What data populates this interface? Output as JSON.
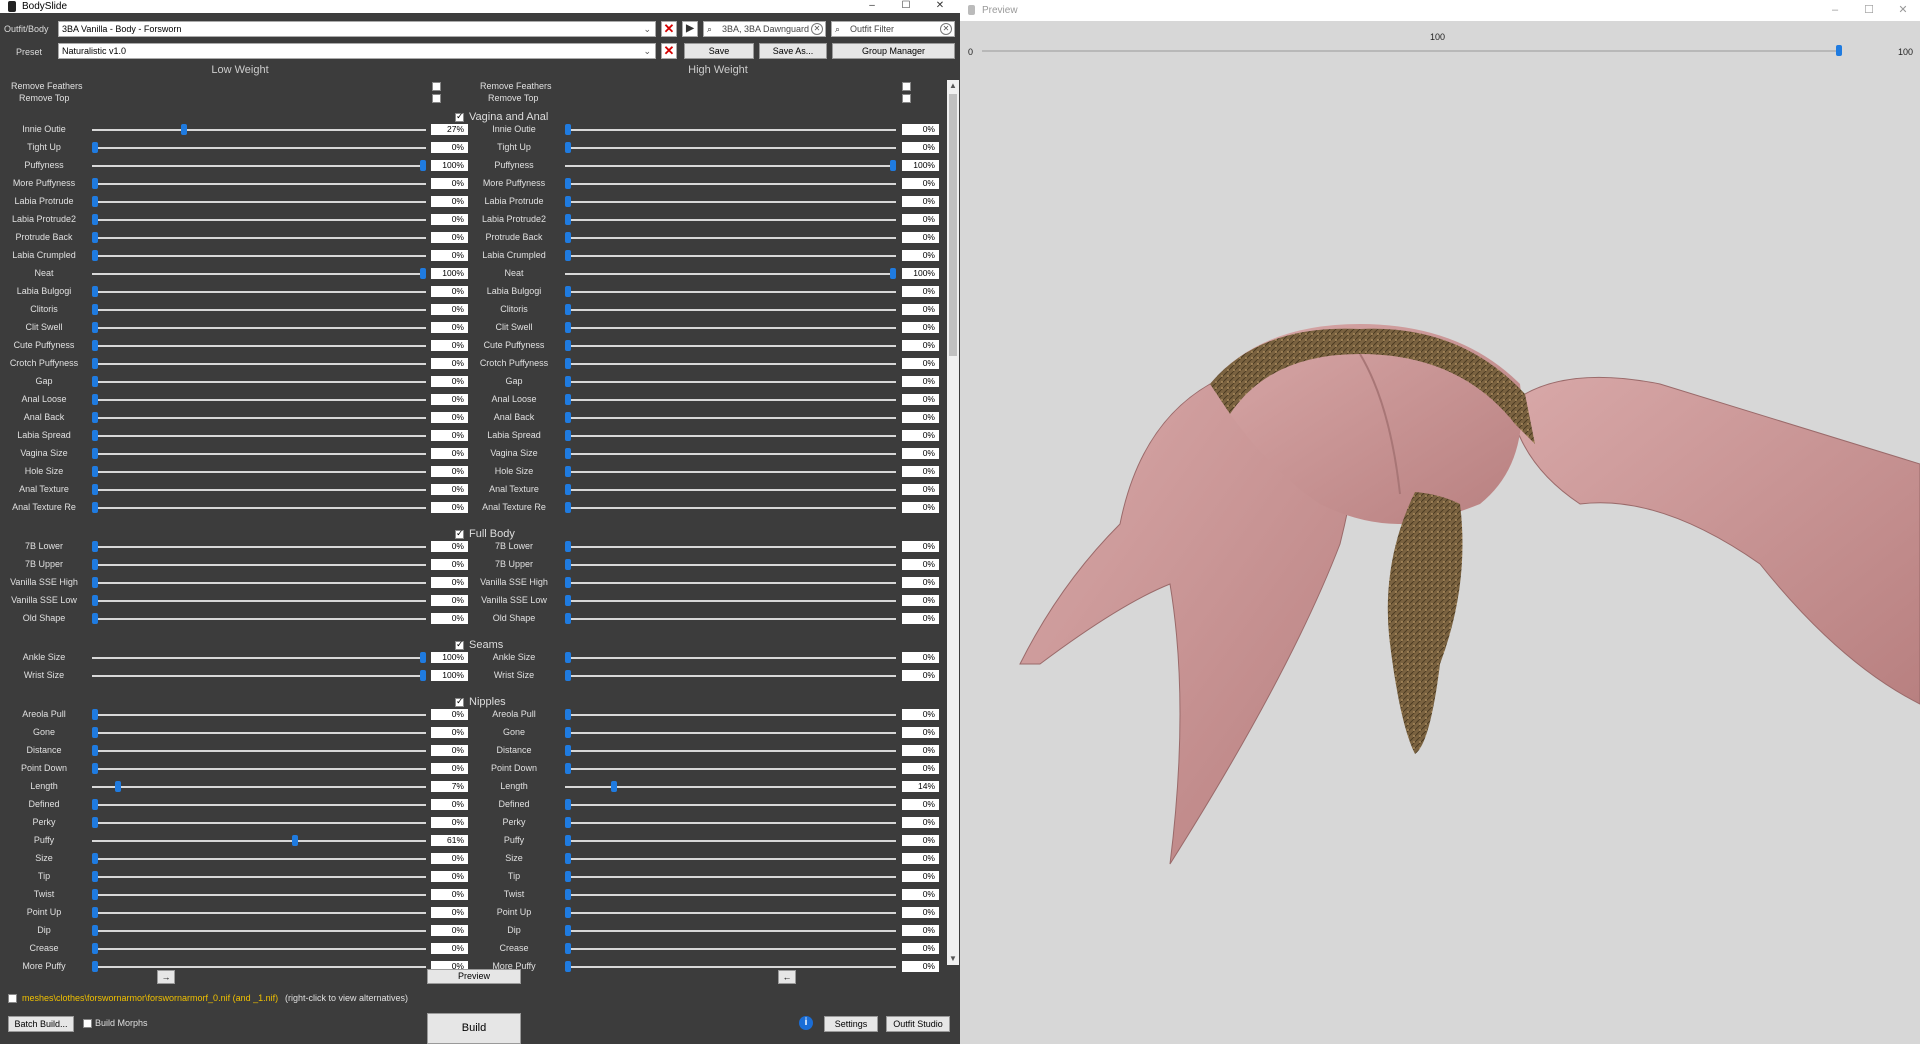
{
  "bodyslide": {
    "title": "BodySlide",
    "outfit_label": "Outfit/Body",
    "outfit_value": "3BA Vanilla - Body - Forsworn",
    "preset_label": "Preset",
    "preset_value": "Naturalistic v1.0",
    "group_filter_value": "3BA, 3BA Dawnguard",
    "outfit_filter_placeholder": "Outfit Filter",
    "save_label": "Save",
    "save_as_label": "Save As...",
    "group_manager_label": "Group Manager",
    "low_weight_label": "Low Weight",
    "high_weight_label": "High Weight",
    "remove_feathers_label": "Remove Feathers",
    "remove_top_label": "Remove Top",
    "low_arrow_label": "→",
    "high_arrow_label": "←",
    "preview_button_label": "Preview",
    "file_path": "meshes\\clothes\\forswornarmor\\forswornarmorf_0.nif (and _1.nif)",
    "file_hint": "(right-click to view alternatives)",
    "batch_build_label": "Batch Build...",
    "build_morphs_label": "Build Morphs",
    "build_label": "Build",
    "info_label": "i",
    "settings_label": "Settings",
    "outfit_studio_label": "Outfit Studio",
    "accent_color": "#1f7be0"
  },
  "groups": [
    {
      "name": "Vagina and Anal",
      "checked": true,
      "sliders": [
        {
          "name": "Innie Outie",
          "low": 27,
          "high": 0
        },
        {
          "name": "Tight Up",
          "low": 0,
          "high": 0
        },
        {
          "name": "Puffyness",
          "low": 100,
          "high": 100
        },
        {
          "name": "More Puffyness",
          "low": 0,
          "high": 0
        },
        {
          "name": "Labia Protrude",
          "low": 0,
          "high": 0
        },
        {
          "name": "Labia Protrude2",
          "low": 0,
          "high": 0
        },
        {
          "name": "Protrude Back",
          "low": 0,
          "high": 0
        },
        {
          "name": "Labia Crumpled",
          "low": 0,
          "high": 0
        },
        {
          "name": "Neat",
          "low": 100,
          "high": 100
        },
        {
          "name": "Labia Bulgogi",
          "low": 0,
          "high": 0
        },
        {
          "name": "Clitoris",
          "low": 0,
          "high": 0
        },
        {
          "name": "Clit Swell",
          "low": 0,
          "high": 0
        },
        {
          "name": "Cute Puffyness",
          "low": 0,
          "high": 0
        },
        {
          "name": "Crotch Puffyness",
          "low": 0,
          "high": 0
        },
        {
          "name": "Gap",
          "low": 0,
          "high": 0
        },
        {
          "name": "Anal Loose",
          "low": 0,
          "high": 0
        },
        {
          "name": "Anal Back",
          "low": 0,
          "high": 0
        },
        {
          "name": "Labia Spread",
          "low": 0,
          "high": 0
        },
        {
          "name": "Vagina Size",
          "low": 0,
          "high": 0
        },
        {
          "name": "Hole Size",
          "low": 0,
          "high": 0
        },
        {
          "name": "Anal Texture",
          "low": 0,
          "high": 0
        },
        {
          "name": "Anal Texture Re",
          "low": 0,
          "high": 0
        }
      ]
    },
    {
      "name": "Full Body",
      "checked": true,
      "sliders": [
        {
          "name": "7B Lower",
          "low": 0,
          "high": 0
        },
        {
          "name": "7B Upper",
          "low": 0,
          "high": 0
        },
        {
          "name": "Vanilla SSE High",
          "low": 0,
          "high": 0
        },
        {
          "name": "Vanilla SSE Low",
          "low": 0,
          "high": 0
        },
        {
          "name": "Old Shape",
          "low": 0,
          "high": 0
        }
      ]
    },
    {
      "name": "Seams",
      "checked": true,
      "sliders": [
        {
          "name": "Ankle Size",
          "low": 100,
          "high": 0
        },
        {
          "name": "Wrist Size",
          "low": 100,
          "high": 0
        }
      ]
    },
    {
      "name": "Nipples",
      "checked": true,
      "sliders": [
        {
          "name": "Areola Pull",
          "low": 0,
          "high": 0
        },
        {
          "name": "Gone",
          "low": 0,
          "high": 0
        },
        {
          "name": "Distance",
          "low": 0,
          "high": 0
        },
        {
          "name": "Point Down",
          "low": 0,
          "high": 0
        },
        {
          "name": "Length",
          "low": 7,
          "high": 14
        },
        {
          "name": "Defined",
          "low": 0,
          "high": 0
        },
        {
          "name": "Perky",
          "low": 0,
          "high": 0
        },
        {
          "name": "Puffy",
          "low": 61,
          "high": 0
        },
        {
          "name": "Size",
          "low": 0,
          "high": 0
        },
        {
          "name": "Tip",
          "low": 0,
          "high": 0
        },
        {
          "name": "Twist",
          "low": 0,
          "high": 0
        },
        {
          "name": "Point Up",
          "low": 0,
          "high": 0
        },
        {
          "name": "Dip",
          "low": 0,
          "high": 0
        },
        {
          "name": "Crease",
          "low": 0,
          "high": 0
        },
        {
          "name": "More Puffy",
          "low": 0,
          "high": 0
        }
      ]
    }
  ],
  "preview": {
    "title": "Preview",
    "weight_min": "0",
    "weight_mid": "100",
    "weight_max": "100",
    "weight_value": 100
  }
}
